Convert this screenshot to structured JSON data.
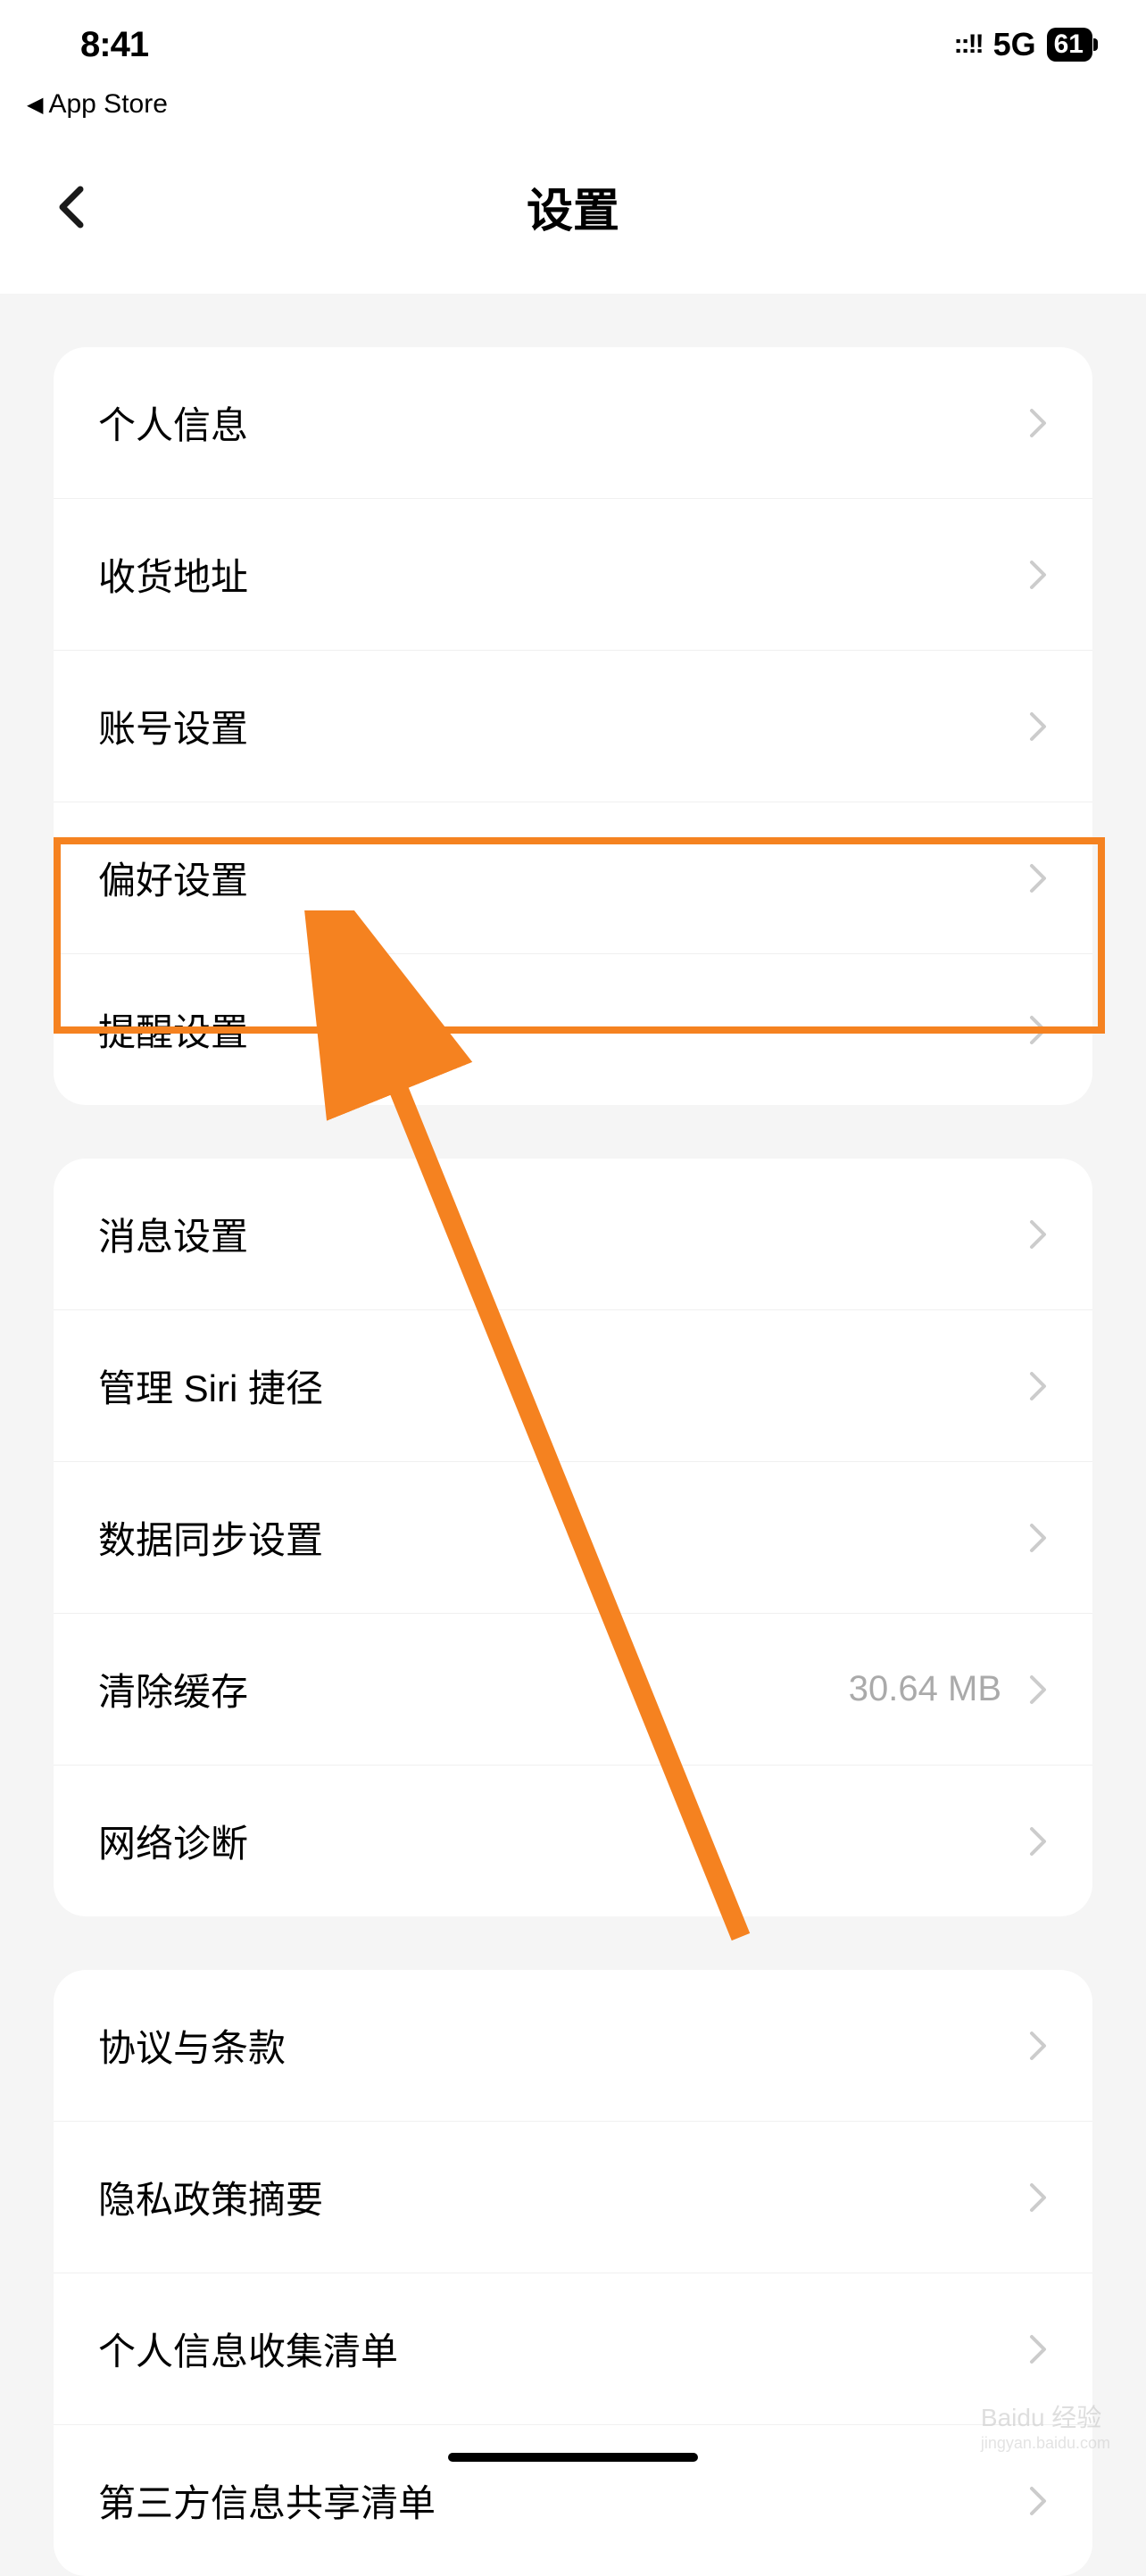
{
  "statusBar": {
    "time": "8:41",
    "signal": "::!!",
    "network": "5G",
    "battery": "61"
  },
  "backApp": {
    "label": "App Store"
  },
  "header": {
    "title": "设置"
  },
  "sections": [
    {
      "rows": [
        {
          "label": "个人信息",
          "value": ""
        },
        {
          "label": "收货地址",
          "value": ""
        },
        {
          "label": "账号设置",
          "value": ""
        },
        {
          "label": "偏好设置",
          "value": ""
        },
        {
          "label": "提醒设置",
          "value": ""
        }
      ]
    },
    {
      "rows": [
        {
          "label": "消息设置",
          "value": ""
        },
        {
          "label": "管理 Siri 捷径",
          "value": ""
        },
        {
          "label": "数据同步设置",
          "value": ""
        },
        {
          "label": "清除缓存",
          "value": "30.64 MB"
        },
        {
          "label": "网络诊断",
          "value": ""
        }
      ]
    },
    {
      "rows": [
        {
          "label": "协议与条款",
          "value": ""
        },
        {
          "label": "隐私政策摘要",
          "value": ""
        },
        {
          "label": "个人信息收集清单",
          "value": ""
        },
        {
          "label": "第三方信息共享清单",
          "value": ""
        }
      ]
    }
  ],
  "watermark": {
    "main": "Baidu 经验",
    "sub": "jingyan.baidu.com"
  }
}
